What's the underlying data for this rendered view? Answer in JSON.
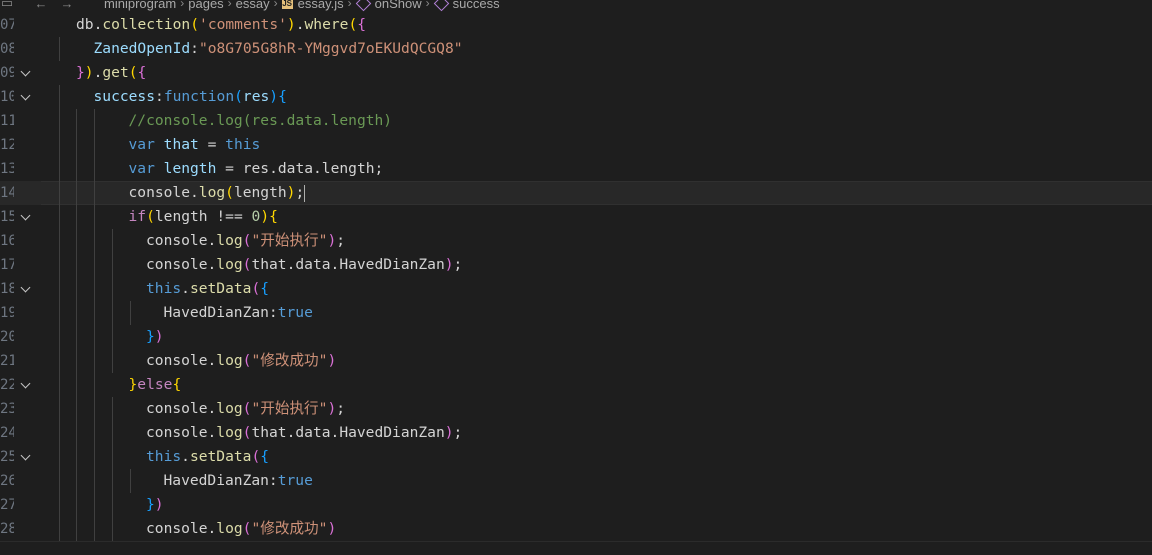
{
  "breadcrumb": {
    "back_glyph": "←",
    "forward_glyph": "→",
    "items": [
      "miniprogram",
      "pages",
      "essay",
      "essay.js",
      "onShow",
      "success"
    ],
    "separator": "›",
    "file_badge": "JS"
  },
  "editor": {
    "current_line": 14,
    "lines": [
      {
        "n": "07",
        "fold": false,
        "tokens": [
          [
            "plain",
            "db."
          ],
          [
            "fn",
            "collection"
          ],
          [
            "b1",
            "("
          ],
          [
            "str",
            "'comments'"
          ],
          [
            "b1",
            ")"
          ],
          [
            "plain",
            "."
          ],
          [
            "fn",
            "where"
          ],
          [
            "b1",
            "("
          ],
          [
            "b2",
            "{"
          ]
        ]
      },
      {
        "n": "08",
        "fold": false,
        "tokens": [
          [
            "prop",
            "ZanedOpenId"
          ],
          [
            "plain",
            ":"
          ],
          [
            "str",
            "\"o8G705G8hR-YMggvd7oEKUdQCGQ8\""
          ]
        ]
      },
      {
        "n": "09",
        "fold": true,
        "tokens": [
          [
            "b2",
            "}"
          ],
          [
            "b1",
            ")"
          ],
          [
            "plain",
            "."
          ],
          [
            "fn",
            "get"
          ],
          [
            "b1",
            "("
          ],
          [
            "b2",
            "{"
          ]
        ]
      },
      {
        "n": "10",
        "fold": true,
        "tokens": [
          [
            "prop",
            "success"
          ],
          [
            "plain",
            ":"
          ],
          [
            "decl",
            "function"
          ],
          [
            "b3",
            "("
          ],
          [
            "prop",
            "res"
          ],
          [
            "b3",
            ")"
          ],
          [
            "b3",
            "{"
          ]
        ]
      },
      {
        "n": "11",
        "fold": false,
        "tokens": [
          [
            "com",
            "//console.log(res.data.length)"
          ]
        ]
      },
      {
        "n": "12",
        "fold": false,
        "tokens": [
          [
            "decl",
            "var"
          ],
          [
            "plain",
            " "
          ],
          [
            "prop",
            "that"
          ],
          [
            "plain",
            " = "
          ],
          [
            "decl",
            "this"
          ]
        ]
      },
      {
        "n": "13",
        "fold": false,
        "tokens": [
          [
            "decl",
            "var"
          ],
          [
            "plain",
            " "
          ],
          [
            "prop",
            "length"
          ],
          [
            "plain",
            " = res.data.length;"
          ]
        ]
      },
      {
        "n": "14",
        "fold": false,
        "tokens": [
          [
            "plain",
            "console."
          ],
          [
            "fn",
            "log"
          ],
          [
            "b1",
            "("
          ],
          [
            "plain",
            "length"
          ],
          [
            "b1",
            ")"
          ],
          [
            "plain",
            ";"
          ],
          [
            "cursor",
            ""
          ]
        ]
      },
      {
        "n": "15",
        "fold": true,
        "tokens": [
          [
            "kw",
            "if"
          ],
          [
            "b1",
            "("
          ],
          [
            "plain",
            "length !== "
          ],
          [
            "num",
            "0"
          ],
          [
            "b1",
            ")"
          ],
          [
            "b1",
            "{"
          ]
        ]
      },
      {
        "n": "16",
        "fold": false,
        "tokens": [
          [
            "plain",
            "console."
          ],
          [
            "fn",
            "log"
          ],
          [
            "b2",
            "("
          ],
          [
            "str",
            "\""
          ],
          [
            "cjk",
            "开始执行"
          ],
          [
            "str",
            "\""
          ],
          [
            "b2",
            ")"
          ],
          [
            "plain",
            ";"
          ]
        ]
      },
      {
        "n": "17",
        "fold": false,
        "tokens": [
          [
            "plain",
            "console."
          ],
          [
            "fn",
            "log"
          ],
          [
            "b2",
            "("
          ],
          [
            "plain",
            "that.data.HavedDianZan"
          ],
          [
            "b2",
            ")"
          ],
          [
            "plain",
            ";"
          ]
        ]
      },
      {
        "n": "18",
        "fold": true,
        "tokens": [
          [
            "decl",
            "this"
          ],
          [
            "plain",
            "."
          ],
          [
            "fn",
            "setData"
          ],
          [
            "b2",
            "("
          ],
          [
            "b3",
            "{"
          ]
        ]
      },
      {
        "n": "19",
        "fold": false,
        "tokens": [
          [
            "plain",
            "HavedDianZan:"
          ],
          [
            "decl",
            "true"
          ]
        ]
      },
      {
        "n": "20",
        "fold": false,
        "tokens": [
          [
            "b3",
            "}"
          ],
          [
            "b2",
            ")"
          ]
        ]
      },
      {
        "n": "21",
        "fold": false,
        "tokens": [
          [
            "plain",
            "console."
          ],
          [
            "fn",
            "log"
          ],
          [
            "b2",
            "("
          ],
          [
            "str",
            "\""
          ],
          [
            "cjk",
            "修改成功"
          ],
          [
            "str",
            "\""
          ],
          [
            "b2",
            ")"
          ]
        ]
      },
      {
        "n": "22",
        "fold": true,
        "tokens": [
          [
            "b1",
            "}"
          ],
          [
            "kw",
            "else"
          ],
          [
            "b1",
            "{"
          ]
        ]
      },
      {
        "n": "23",
        "fold": false,
        "tokens": [
          [
            "plain",
            "console."
          ],
          [
            "fn",
            "log"
          ],
          [
            "b2",
            "("
          ],
          [
            "str",
            "\""
          ],
          [
            "cjk",
            "开始执行"
          ],
          [
            "str",
            "\""
          ],
          [
            "b2",
            ")"
          ],
          [
            "plain",
            ";"
          ]
        ]
      },
      {
        "n": "24",
        "fold": false,
        "tokens": [
          [
            "plain",
            "console."
          ],
          [
            "fn",
            "log"
          ],
          [
            "b2",
            "("
          ],
          [
            "plain",
            "that.data.HavedDianZan"
          ],
          [
            "b2",
            ")"
          ],
          [
            "plain",
            ";"
          ]
        ]
      },
      {
        "n": "25",
        "fold": true,
        "tokens": [
          [
            "decl",
            "this"
          ],
          [
            "plain",
            "."
          ],
          [
            "fn",
            "setData"
          ],
          [
            "b2",
            "("
          ],
          [
            "b3",
            "{"
          ]
        ]
      },
      {
        "n": "26",
        "fold": false,
        "tokens": [
          [
            "plain",
            "HavedDianZan:"
          ],
          [
            "decl",
            "true"
          ]
        ]
      },
      {
        "n": "27",
        "fold": false,
        "tokens": [
          [
            "b3",
            "}"
          ],
          [
            "b2",
            ")"
          ]
        ]
      },
      {
        "n": "28",
        "fold": false,
        "tokens": [
          [
            "plain",
            "console."
          ],
          [
            "fn",
            "log"
          ],
          [
            "b2",
            "("
          ],
          [
            "str",
            "\""
          ],
          [
            "cjk",
            "修改成功"
          ],
          [
            "str",
            "\""
          ],
          [
            "b2",
            ")"
          ]
        ]
      }
    ]
  },
  "colors": {
    "background": "#1e1e1e",
    "current_line": "#282828",
    "keyword": "#c586c0",
    "declaration": "#569cd6",
    "string": "#ce9178",
    "function": "#dcdcaa",
    "property": "#9cdcfe",
    "comment": "#6a9955"
  }
}
